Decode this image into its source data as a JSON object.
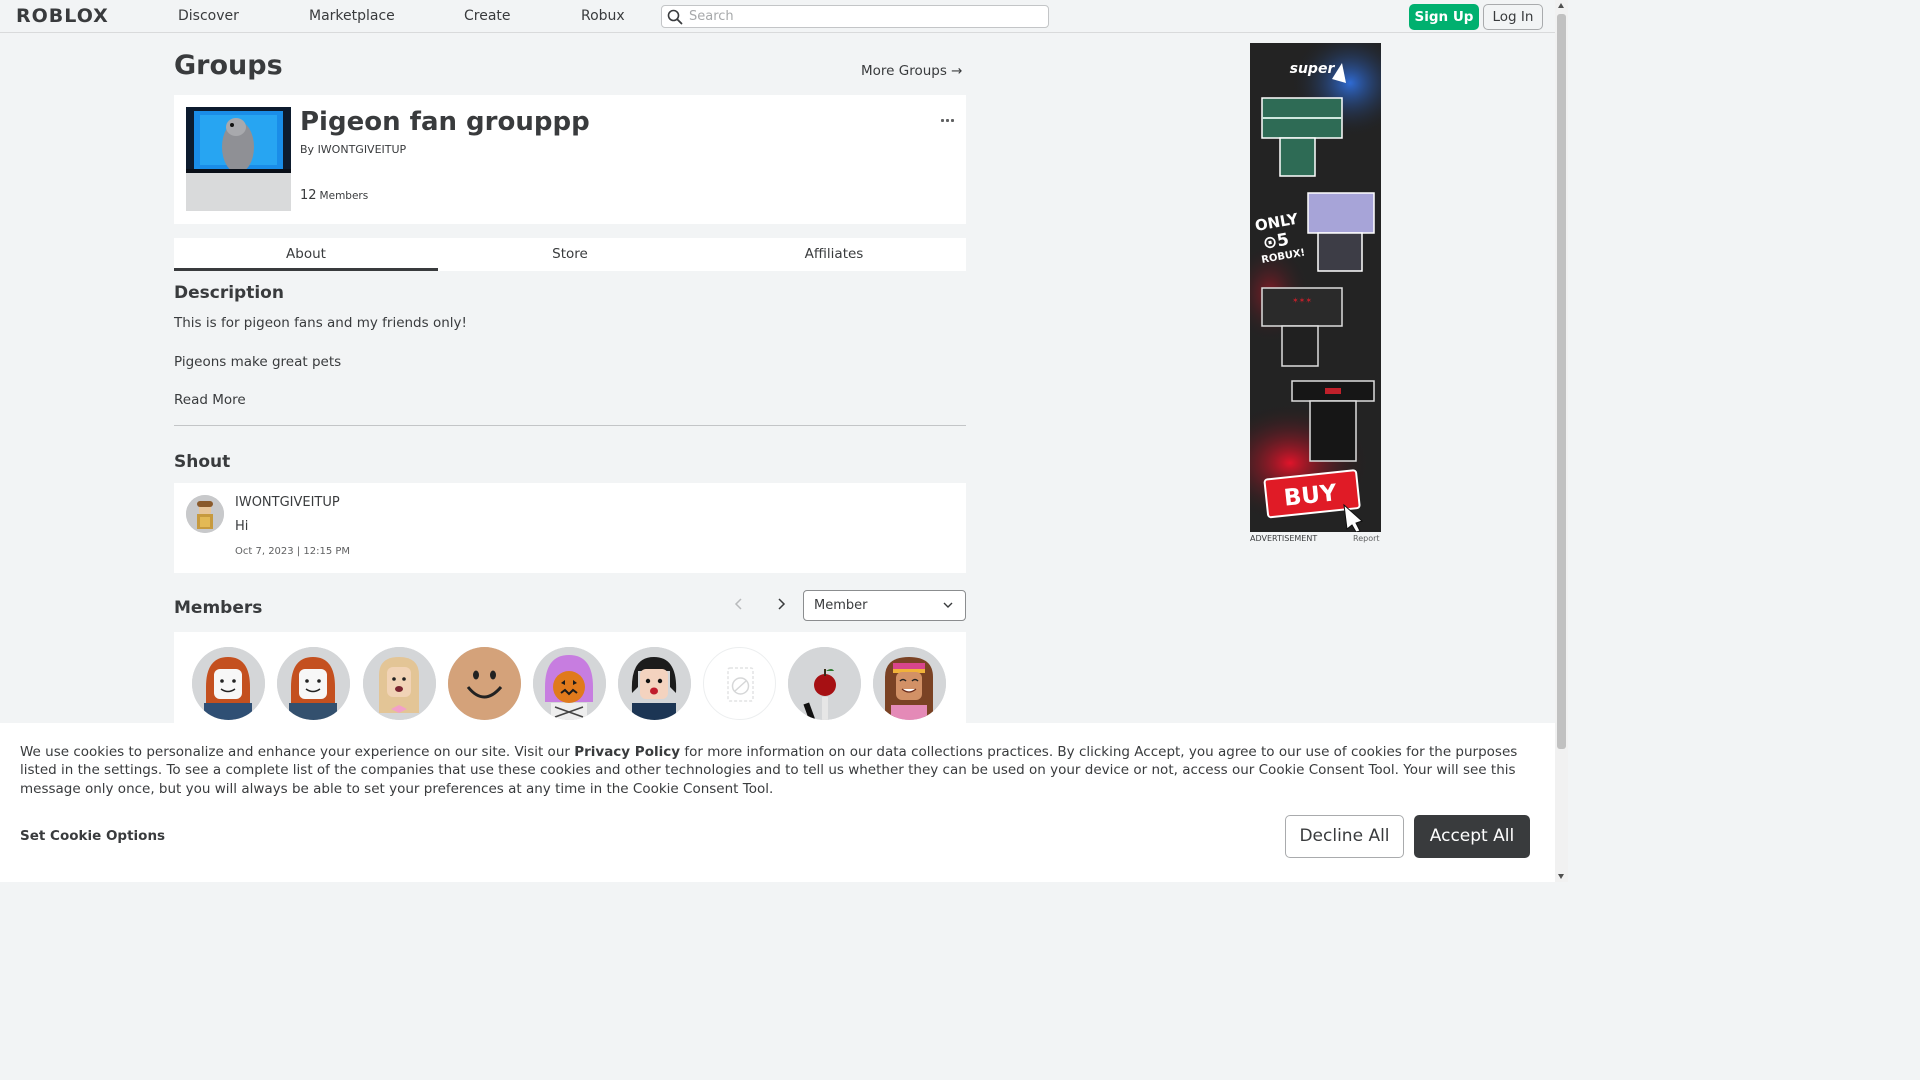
{
  "nav": {
    "logo": "ROBLOX",
    "links": [
      "Discover",
      "Marketplace",
      "Create",
      "Robux"
    ],
    "search_placeholder": "Search",
    "signup": "Sign Up",
    "login": "Log In"
  },
  "page": {
    "title": "Groups",
    "more_groups": "More Groups →"
  },
  "group": {
    "name": "Pigeon fan grouppp",
    "by_prefix": "By ",
    "owner": "IWONTGIVEITUP",
    "member_count": "12",
    "members_label": "Members"
  },
  "tabs": [
    "About",
    "Store",
    "Affiliates"
  ],
  "about": {
    "description_heading": "Description",
    "description_lines": [
      "This is for pigeon fans and my friends only!",
      "Pigeons make great pets"
    ],
    "read_more": "Read More"
  },
  "shout": {
    "heading": "Shout",
    "user": "IWONTGIVEITUP",
    "message": "Hi",
    "date": "Oct 7, 2023 | 12:15 PM"
  },
  "members": {
    "heading": "Members",
    "role_selected": "Member",
    "avatar_count": 9
  },
  "ad": {
    "label": "ADVERTISEMENT",
    "report": "Report",
    "brand": "super",
    "promo": "ONLY 5 ROBUX!",
    "cta": "BUY"
  },
  "cookie": {
    "text_before": "We use cookies to personalize and enhance your experience on our site. Visit our ",
    "privacy_link": "Privacy Policy",
    "text_after": " for more information on our data collections practices. By clicking Accept, you agree to our use of cookies for the purposes listed in the settings. To see a complete list of the companies that use these cookies and other technologies and to tell us whether they can be used on your device or not, access our Cookie Consent Tool. Your will see this message only once, but you will always be able to set your preferences at any time in the Cookie Consent Tool.",
    "set_options": "Set Cookie Options",
    "decline": "Decline All",
    "accept": "Accept All"
  },
  "colors": {
    "signup_green": "#00b06f",
    "text_dark": "#393b3d",
    "page_bg": "#f2f4f5",
    "accept_bg": "#393b3d"
  }
}
